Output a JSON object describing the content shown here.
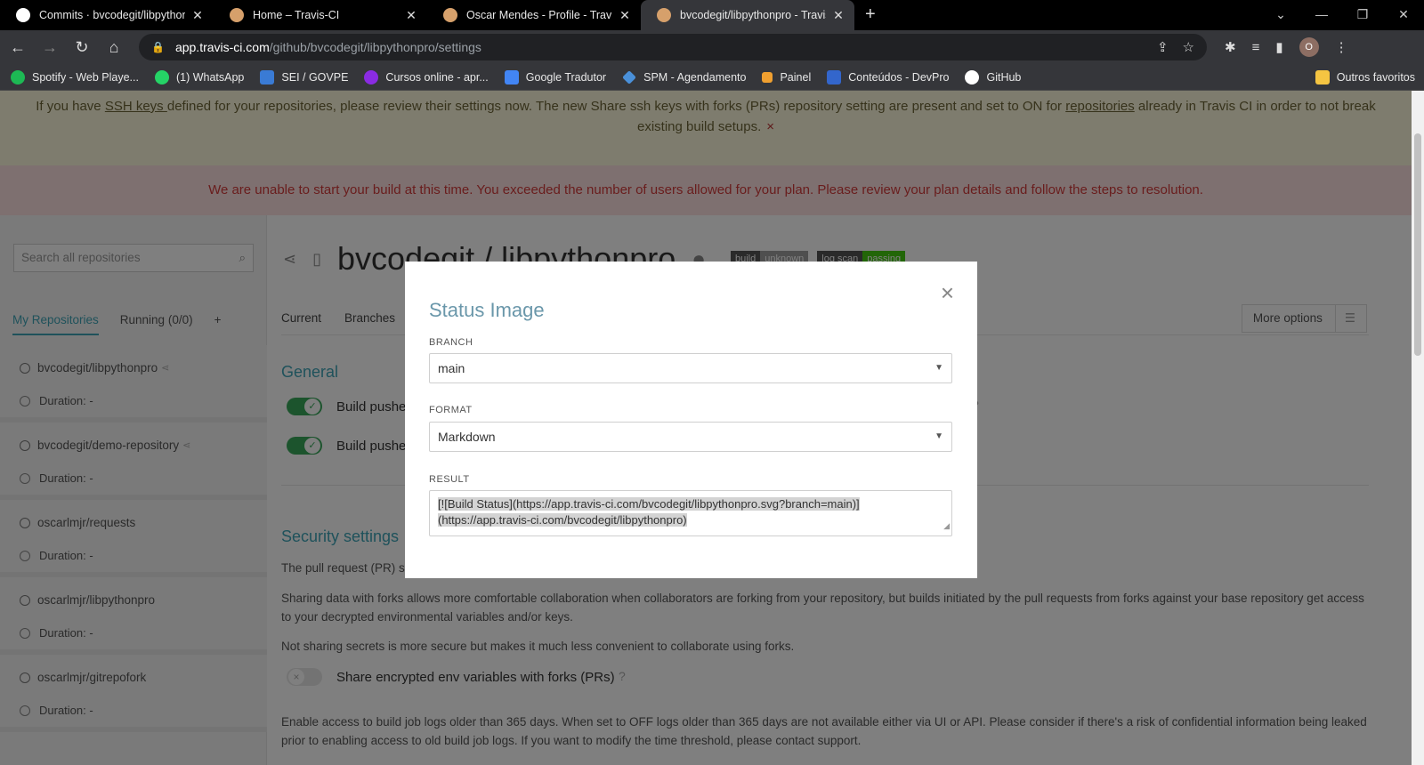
{
  "browser": {
    "tabs": [
      {
        "title": "Commits · bvcodegit/libpythonpro",
        "favicon_color": "#ffffff"
      },
      {
        "title": "Home – Travis-CI",
        "favicon_color": "#d6a06b"
      },
      {
        "title": "Oscar Mendes - Profile - Travis CI",
        "favicon_color": "#d6a06b"
      },
      {
        "title": "bvcodegit/libpythonpro - Travis CI",
        "favicon_color": "#d6a06b"
      }
    ],
    "url_host": "app.travis-ci.com",
    "url_path": "/github/bvcodegit/libpythonpro/settings",
    "avatar_letter": "O",
    "bookmarks": [
      {
        "label": "Spotify - Web Playe...",
        "color": "#1db954"
      },
      {
        "label": "(1) WhatsApp",
        "color": "#25d366"
      },
      {
        "label": "SEI / GOVPE",
        "color": "#3a7bd5"
      },
      {
        "label": "Cursos online - apr...",
        "color": "#8a2be2"
      },
      {
        "label": "Google Tradutor",
        "color": "#4285f4"
      },
      {
        "label": "SPM - Agendamento",
        "color": "#4a90d9"
      },
      {
        "label": "Painel",
        "color": "#f0a030"
      },
      {
        "label": "Conteúdos - DevPro",
        "color": "#3366cc"
      },
      {
        "label": "GitHub",
        "color": "#ffffff"
      }
    ],
    "other_bookmarks": "Outros favoritos"
  },
  "banners": {
    "warn_1": "If you have ",
    "warn_link1": "SSH keys ",
    "warn_2": "defined for your repositories, please review their settings now. The new Share ssh keys with forks (PRs) repository setting are present and set to ON for ",
    "warn_link2": "repositories",
    "warn_3": " already in Travis CI in order to not break existing build setups.",
    "warn_close": "×",
    "error": "We are unable to start your build at this time. You exceeded the number of users allowed for your plan. Please review your plan details and follow the steps to resolution."
  },
  "sidebar": {
    "search_placeholder": "Search all repositories",
    "tabs": [
      "My Repositories",
      "Running (0/0)",
      "+"
    ],
    "repos": [
      {
        "name": "bvcodegit/libpythonpro",
        "duration": "Duration: -"
      },
      {
        "name": "bvcodegit/demo-repository",
        "duration": "Duration: -"
      },
      {
        "name": "oscarlmjr/requests",
        "duration": "Duration: -"
      },
      {
        "name": "oscarlmjr/libpythonpro",
        "duration": "Duration: -"
      },
      {
        "name": "oscarlmjr/gitrepofork",
        "duration": "Duration: -"
      }
    ]
  },
  "main": {
    "repo_title": "bvcodegit / libpythonpro",
    "badge_build": [
      "build",
      "unknown"
    ],
    "badge_log": [
      "log scan",
      "passing"
    ],
    "tabs": [
      "Current",
      "Branches"
    ],
    "more_options": "More options",
    "general_heading": "General",
    "toggle1_label": "Build pushe",
    "toggle2_label": "Build pushe",
    "security_heading": "Security settings",
    "pr_text": "The pull request (PR) set",
    "sharing_text": "Sharing data with forks allows more comfortable collaboration when collaborators are forking from your repository, but builds initiated by the pull requests from forks against your base repository get access to your decrypted environmental variables and/or keys.",
    "not_sharing_text": "Not sharing secrets is more secure but makes it much less convenient to collaborate using forks.",
    "share_env_label": "Share encrypted env variables with forks (PRs)",
    "logs_text": "Enable access to build job logs older than 365 days. When set to OFF logs older than 365 days are not available either via UI or API. Please consider if there's a risk of confidential information being leaked prior to enabling access to old build job logs. If you want to modify the time threshold, please contact support."
  },
  "modal": {
    "title": "Status Image",
    "branch_label": "BRANCH",
    "branch_value": "main",
    "format_label": "FORMAT",
    "format_value": "Markdown",
    "result_label": "RESULT",
    "result_line1": "[![Build Status](https://app.travis-ci.com/bvcodegit/libpythonpro.svg?branch=main)]",
    "result_line2": "(https://app.travis-ci.com/bvcodegit/libpythonpro)",
    "close": "×"
  }
}
